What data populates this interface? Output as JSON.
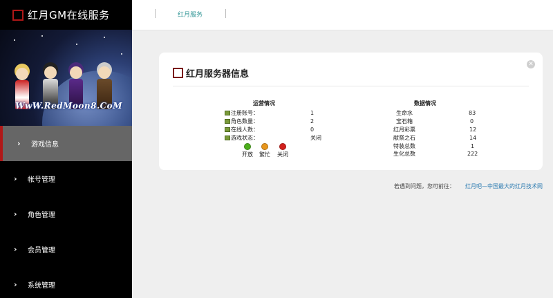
{
  "app": {
    "title": "红月GM在线服务",
    "banner_text": "WwW.RedMoon8.CoM"
  },
  "sidebar": {
    "items": [
      {
        "label": "游戏信息",
        "active": true
      },
      {
        "label": "帐号管理"
      },
      {
        "label": "角色管理"
      },
      {
        "label": "会员管理"
      },
      {
        "label": "系统管理"
      }
    ]
  },
  "topbar": {
    "tab": "红月服务"
  },
  "panel": {
    "title": "红月服务器信息",
    "operations": {
      "heading": "运营情况",
      "rows": [
        {
          "label": "注册账号：",
          "value": "1"
        },
        {
          "label": "角色数量：",
          "value": "2"
        },
        {
          "label": "在线人数：",
          "value": "0"
        },
        {
          "label": "游戏状态：",
          "value": "关闭"
        }
      ],
      "legend": [
        {
          "label": "开放",
          "color": "#4caf1c"
        },
        {
          "label": "繁忙",
          "color": "#e8961c"
        },
        {
          "label": "关闭",
          "color": "#d2201c"
        }
      ]
    },
    "data": {
      "heading": "数据情况",
      "rows": [
        {
          "label": "生命水",
          "value": "83"
        },
        {
          "label": "宝石箱",
          "value": "0"
        },
        {
          "label": "红月彩票",
          "value": "12"
        },
        {
          "label": "献祭之石",
          "value": "14"
        },
        {
          "label": "特装总数",
          "value": "1"
        },
        {
          "label": "生化总数",
          "value": "222"
        }
      ]
    }
  },
  "footer": {
    "text": "若遇到问题，您可前往：",
    "link": "红月吧—中国最大的红月技术网"
  },
  "colors": {
    "accent": "#b01818",
    "tab_text": "#3a9a9a",
    "link": "#2a7ab0"
  }
}
